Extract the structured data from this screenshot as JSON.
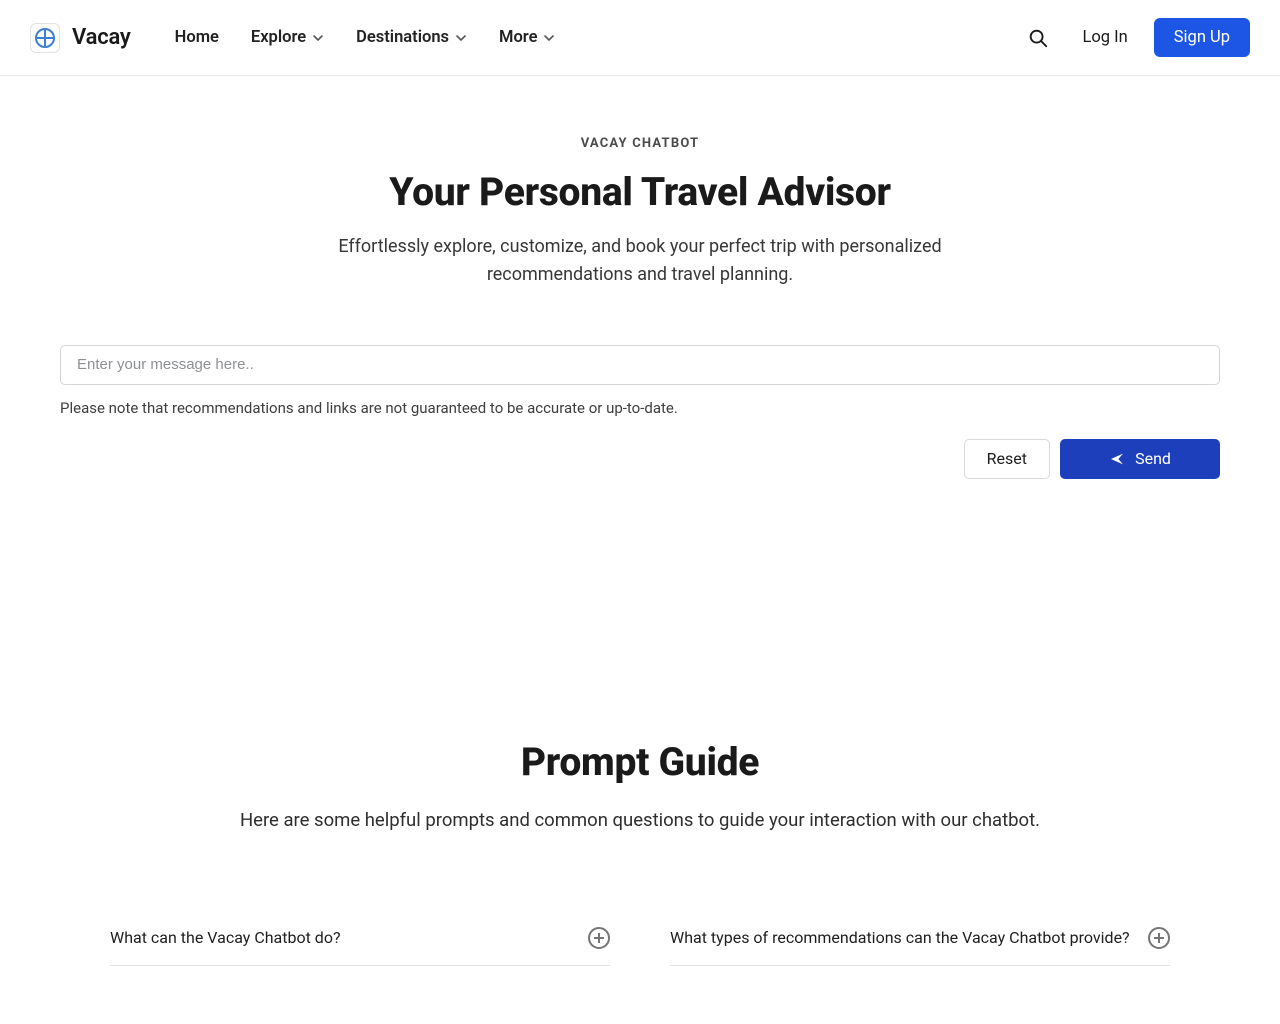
{
  "brand": "Vacay",
  "nav": {
    "home": "Home",
    "explore": "Explore",
    "destinations": "Destinations",
    "more": "More"
  },
  "auth": {
    "login": "Log In",
    "signup": "Sign Up"
  },
  "hero": {
    "eyebrow": "VACAY CHATBOT",
    "title": "Your Personal Travel Advisor",
    "subtitle": "Effortlessly explore, customize, and book your perfect trip with personalized recommendations and travel planning."
  },
  "chat": {
    "placeholder": "Enter your message here..",
    "disclaimer": "Please note that recommendations and links are not guaranteed to be accurate or up-to-date.",
    "reset": "Reset",
    "send": "Send"
  },
  "guide": {
    "title": "Prompt Guide",
    "subtitle": "Here are some helpful prompts and common questions to guide your interaction with our chatbot."
  },
  "faq_left": {
    "q1": "What can the Vacay Chatbot do?"
  },
  "faq_right": {
    "q1": "What types of recommendations can the Vacay Chatbot provide?"
  }
}
